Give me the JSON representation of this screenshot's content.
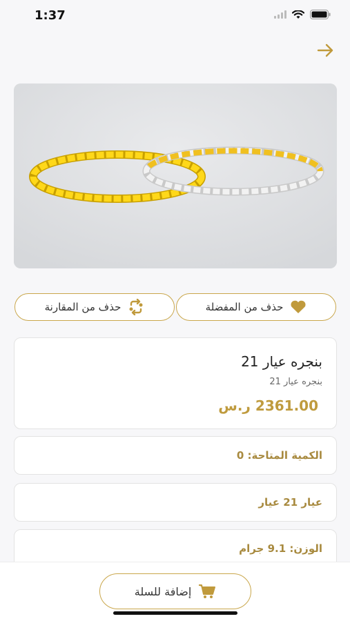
{
  "status_bar": {
    "time": "1:37"
  },
  "header": {
    "back_icon": "arrow-right-icon"
  },
  "product_image": {
    "subject": "gold bangles"
  },
  "actions": {
    "favorite_label": "حذف من المفضلة",
    "favorite_icon": "heart-icon",
    "compare_label": "حذف من المقارنة",
    "compare_icon": "compare-arrows-icon"
  },
  "product": {
    "name": "بنجره عيار 21",
    "subtitle": "بنجره عيار 21",
    "price": "2361.00 ر.س"
  },
  "details": {
    "quantity": "الكمية المتاحة: 0",
    "karat": "عيار 21 عيار",
    "weight": "الوزن: 9.1 جرام"
  },
  "bottom": {
    "add_to_cart_label": "إضافة للسلة",
    "cart_icon": "cart-icon"
  },
  "colors": {
    "accent": "#c9a64a",
    "price": "#bf9b3e",
    "info": "#a88a3f"
  }
}
